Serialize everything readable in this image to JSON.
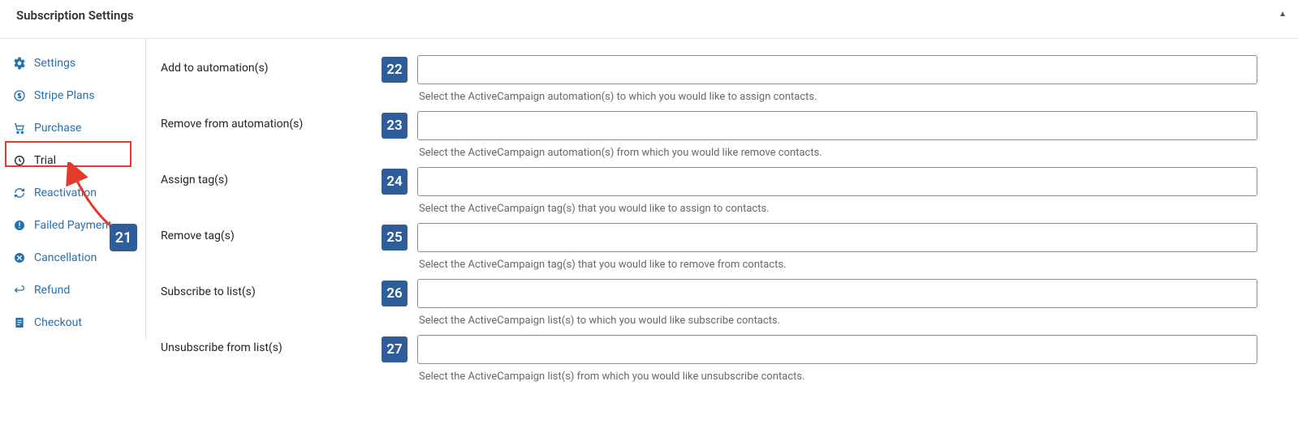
{
  "header": {
    "title": "Subscription Settings",
    "toggle_glyph": "▲"
  },
  "sidebar": {
    "items": [
      {
        "key": "settings",
        "label": "Settings",
        "icon": "gear-icon"
      },
      {
        "key": "stripe-plans",
        "label": "Stripe Plans",
        "icon": "dollar-circle-icon"
      },
      {
        "key": "purchase",
        "label": "Purchase",
        "icon": "cart-icon"
      },
      {
        "key": "trial",
        "label": "Trial",
        "icon": "clock-icon",
        "active": true
      },
      {
        "key": "reactivation",
        "label": "Reactivation",
        "icon": "refresh-icon"
      },
      {
        "key": "failed-payment",
        "label": "Failed Payment",
        "icon": "alert-circle-icon"
      },
      {
        "key": "cancellation",
        "label": "Cancellation",
        "icon": "x-circle-icon"
      },
      {
        "key": "refund",
        "label": "Refund",
        "icon": "return-icon"
      },
      {
        "key": "checkout",
        "label": "Checkout",
        "icon": "document-icon"
      }
    ]
  },
  "annotations": {
    "sidebar_callout": "21",
    "field_callouts": [
      "22",
      "23",
      "24",
      "25",
      "26",
      "27"
    ]
  },
  "form": {
    "rows": [
      {
        "key": "add-automation",
        "label": "Add to automation(s)",
        "hint": "Select the ActiveCampaign automation(s) to which you would like to assign contacts."
      },
      {
        "key": "remove-automation",
        "label": "Remove from automation(s)",
        "hint": "Select the ActiveCampaign automation(s) from which you would like remove contacts."
      },
      {
        "key": "assign-tags",
        "label": "Assign tag(s)",
        "hint": "Select the ActiveCampaign tag(s) that you would like to assign to contacts."
      },
      {
        "key": "remove-tags",
        "label": "Remove tag(s)",
        "hint": "Select the ActiveCampaign tag(s) that you would like to remove from contacts."
      },
      {
        "key": "subscribe-lists",
        "label": "Subscribe to list(s)",
        "hint": "Select the ActiveCampaign list(s) to which you would like subscribe contacts."
      },
      {
        "key": "unsubscribe-lists",
        "label": "Unsubscribe from list(s)",
        "hint": "Select the ActiveCampaign list(s) from which you would like unsubscribe contacts."
      }
    ]
  }
}
